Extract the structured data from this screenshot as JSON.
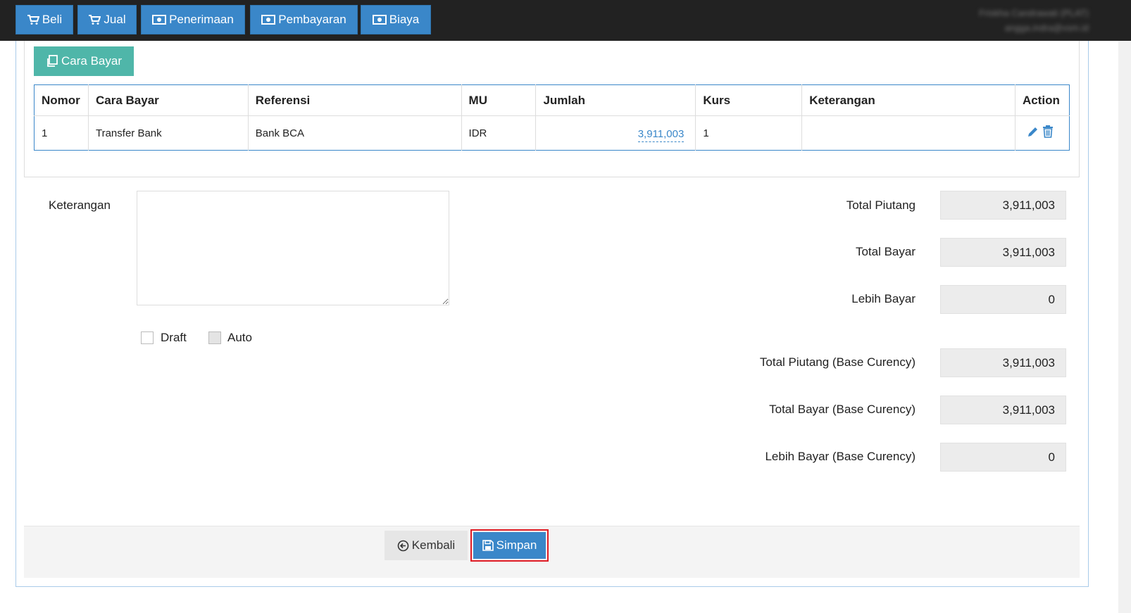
{
  "nav": {
    "buttons": [
      {
        "label": "Beli",
        "icon": "cart-icon"
      },
      {
        "label": "Jual",
        "icon": "cart-icon"
      },
      {
        "label": "Penerimaan",
        "icon": "money-icon"
      },
      {
        "label": "Pembayaran",
        "icon": "money-icon"
      },
      {
        "label": "Biaya",
        "icon": "money-icon"
      }
    ],
    "user_name": "Friskha Candrawati (PLAT)",
    "user_email": "angga.indra@vsm.id"
  },
  "payment": {
    "add_button_label": "Cara Bayar",
    "columns": [
      "Nomor",
      "Cara Bayar",
      "Referensi",
      "MU",
      "Jumlah",
      "Kurs",
      "Keterangan",
      "Action"
    ],
    "rows": [
      {
        "nomor": "1",
        "cara_bayar": "Transfer Bank",
        "referensi": "Bank BCA",
        "mu": "IDR",
        "jumlah": "3,911,003",
        "kurs": "1",
        "keterangan": ""
      }
    ]
  },
  "form": {
    "keterangan_label": "Keterangan",
    "keterangan_value": "",
    "draft_label": "Draft",
    "auto_label": "Auto"
  },
  "totals": [
    {
      "label": "Total Piutang",
      "value": "3,911,003"
    },
    {
      "label": "Total Bayar",
      "value": "3,911,003"
    },
    {
      "label": "Lebih Bayar",
      "value": "0"
    },
    {
      "label": "Total Piutang (Base Curency)",
      "value": "3,911,003"
    },
    {
      "label": "Total Bayar (Base Curency)",
      "value": "3,911,003"
    },
    {
      "label": "Lebih Bayar (Base Curency)",
      "value": "0"
    }
  ],
  "footer": {
    "back_label": "Kembali",
    "save_label": "Simpan"
  },
  "colors": {
    "primary": "#3a87c9",
    "teal": "#4fb6a9",
    "topbar": "#222222",
    "highlight": "#e01b24"
  }
}
